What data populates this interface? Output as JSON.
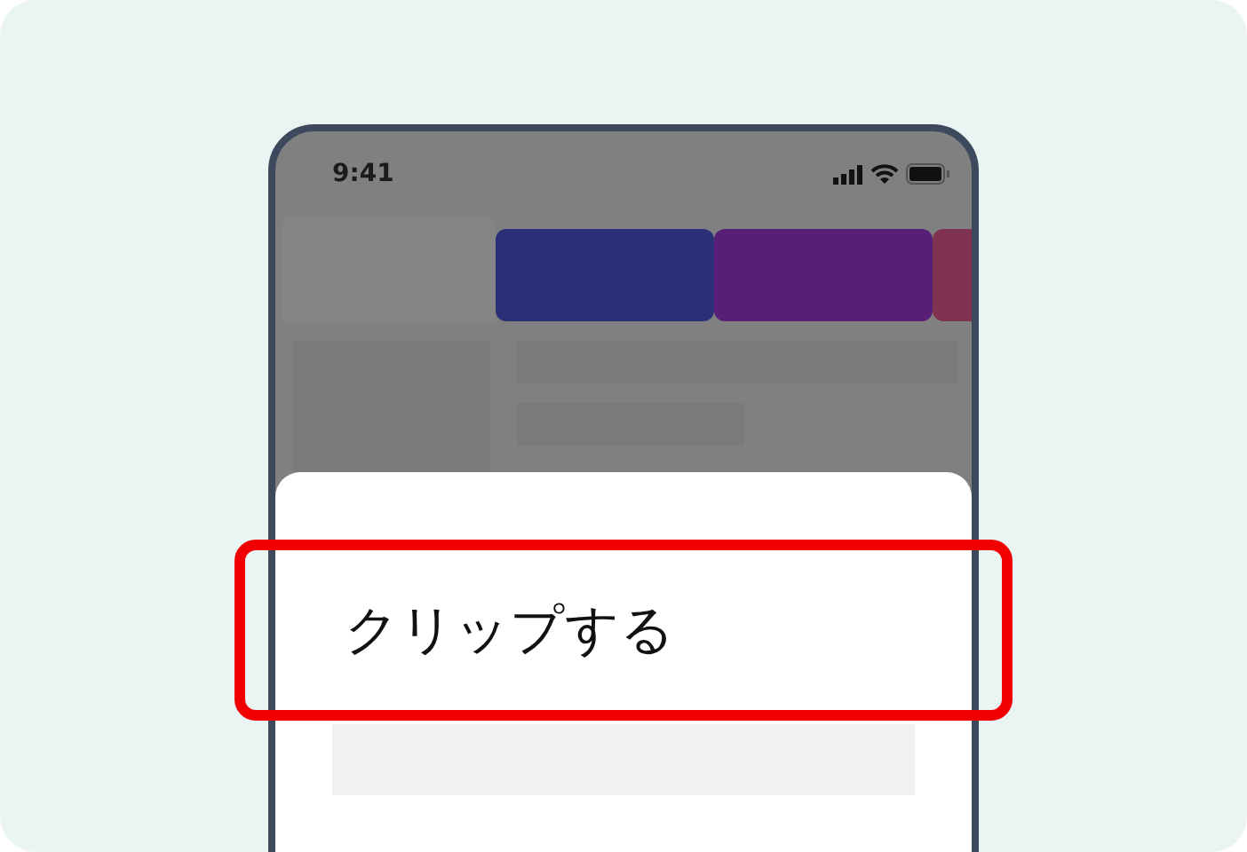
{
  "status_bar": {
    "time": "9:41"
  },
  "tabs": [
    {
      "color": "#2b2f78"
    },
    {
      "color": "#581e78"
    },
    {
      "color": "#7f3350"
    }
  ],
  "sheet": {
    "items": [
      {
        "label": "クリップする",
        "highlighted": true
      }
    ]
  }
}
